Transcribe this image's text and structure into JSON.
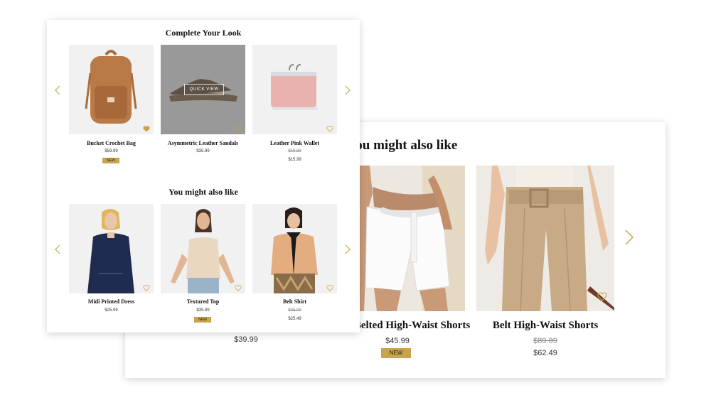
{
  "back_panel": {
    "title": "You might also like",
    "products": [
      {
        "name": "",
        "price": "$39.99"
      },
      {
        "name": "Belted High-Waist Shorts",
        "price": "$45.99",
        "badge": "NEW"
      },
      {
        "name": "Belt High-Waist Shorts",
        "old_price": "$89.89",
        "price": "$62.49"
      }
    ]
  },
  "front_panel": {
    "section1": {
      "title": "Complete Your Look",
      "products": [
        {
          "name": "Bucket Crochet Bag",
          "price": "$59.99",
          "badge": "NEW"
        },
        {
          "name": "Asymmetric Leather Sandals",
          "price": "$35.99",
          "overlay": "QUICK VIEW"
        },
        {
          "name": "Leather Pink Wallet",
          "old_price": "$19.89",
          "price": "$15.99"
        }
      ]
    },
    "section2": {
      "title": "You might also like",
      "products": [
        {
          "name": "Midi Printed Dress",
          "price": "$25.99"
        },
        {
          "name": "Textured Top",
          "price": "$35.99",
          "badge": "NEW"
        },
        {
          "name": "Belt Shirt",
          "old_price": "$35.99",
          "price": "$25.49"
        }
      ]
    }
  },
  "colors": {
    "accent": "#c9a44c",
    "background": "#ffffff",
    "image_bg": "#f1f1f1"
  },
  "icons": {
    "prev": "chevron-left-icon",
    "next": "chevron-right-icon",
    "wishlist": "heart-icon"
  }
}
